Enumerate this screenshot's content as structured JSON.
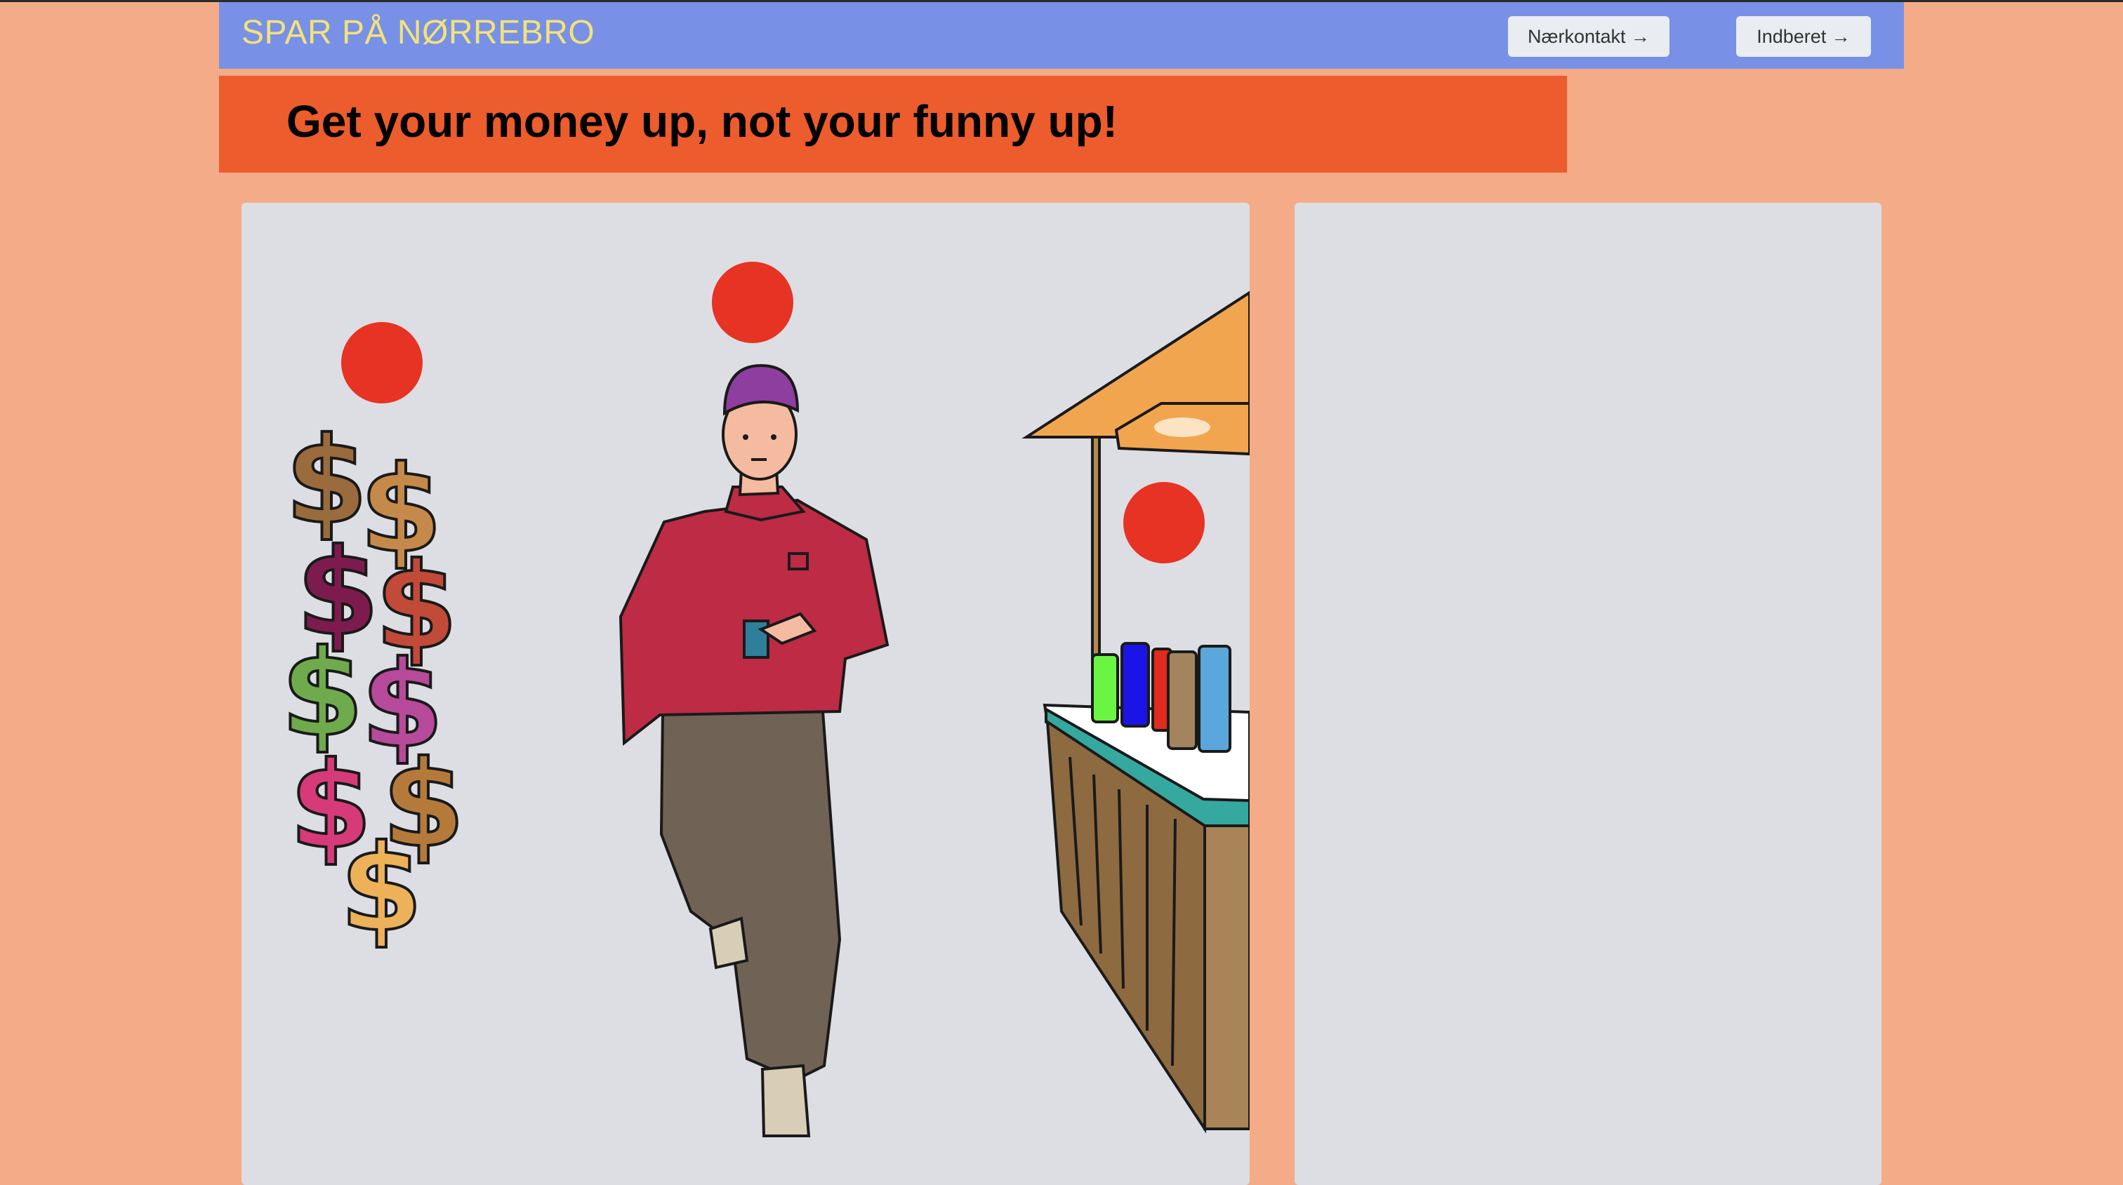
{
  "navbar": {
    "brand": "SPAR PÅ NØRREBRO",
    "buttons": [
      {
        "label": "Nærkontakt →"
      },
      {
        "label": "Indberet →"
      }
    ]
  },
  "banner": {
    "headline": "Get your money up, not your funny up!"
  },
  "colors": {
    "background": "#F4AB87",
    "navbar": "#7891E6",
    "brand_text": "#F3E27A",
    "banner": "#ED5C2C",
    "panel": "#DDDEE3",
    "marker": "#E63323"
  },
  "illustration": {
    "markers_count": 3,
    "dollar_signs_count": 9
  }
}
